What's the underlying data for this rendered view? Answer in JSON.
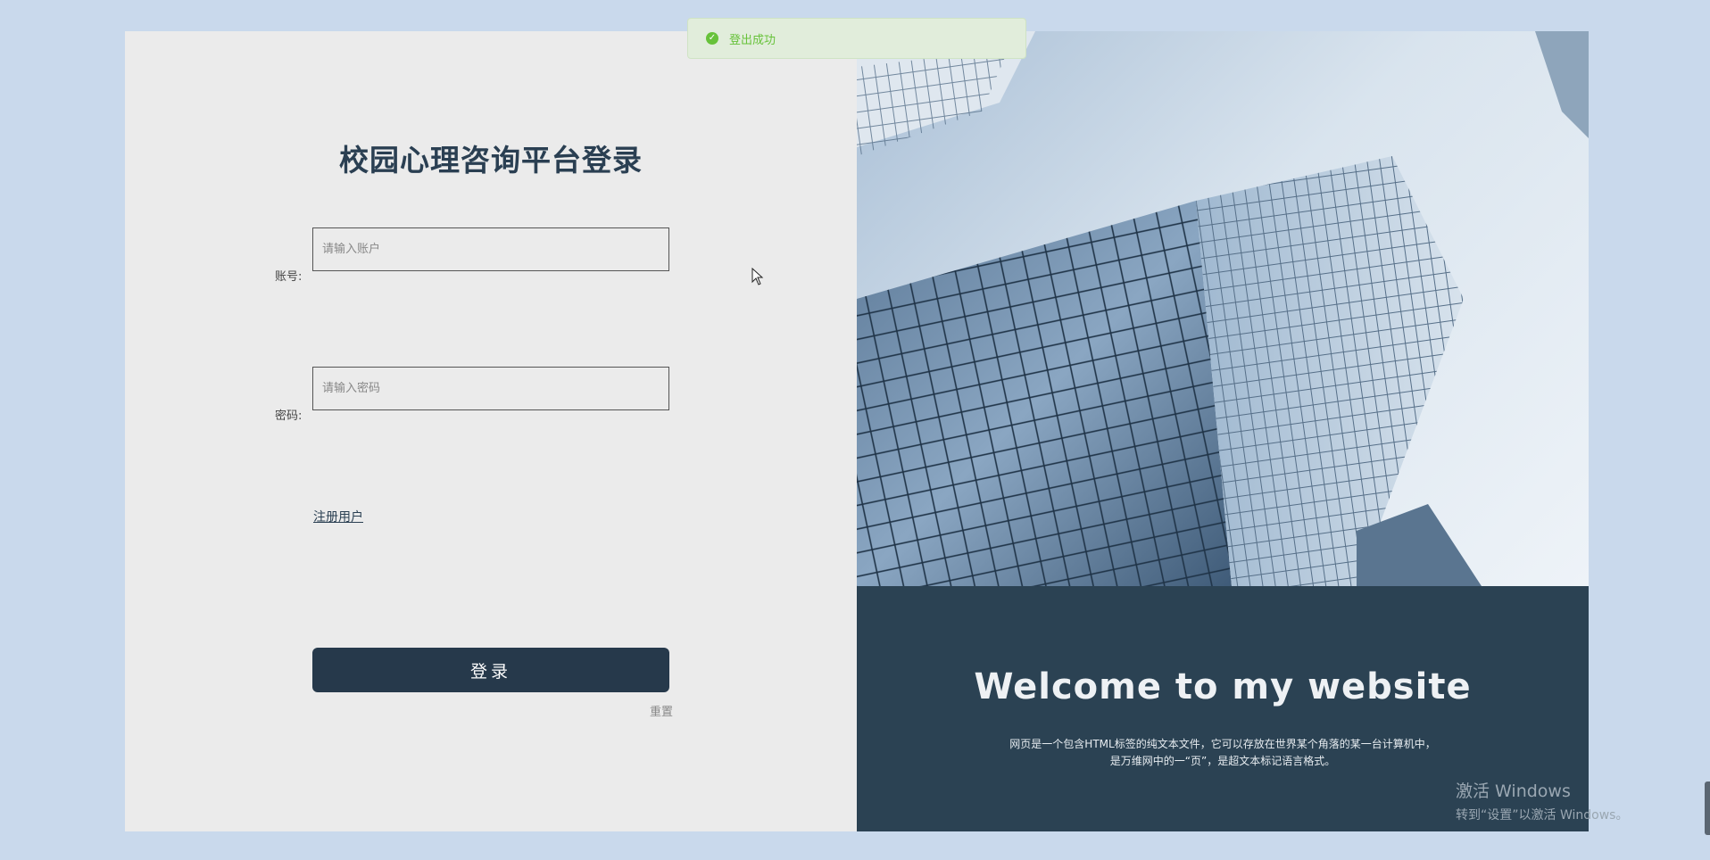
{
  "login": {
    "title": "校园心理咨询平台登录",
    "account_label": "账号:",
    "account_placeholder": "请输入账户",
    "password_label": "密码:",
    "password_placeholder": "请输入密码",
    "register_link": "注册用户",
    "login_button": "登录",
    "reset_link": "重置"
  },
  "hero": {
    "welcome_title": "Welcome to my website",
    "welcome_desc_line1": "网页是一个包含HTML标签的纯文本文件，它可以存放在世界某个角落的某一台计算机中，",
    "welcome_desc_line2": "是万维网中的一“页”，是超文本标记语言格式。"
  },
  "toast": {
    "message": "登出成功",
    "icon": "check-circle-icon",
    "color": "#67c23a"
  },
  "watermark": {
    "title": "激活 Windows",
    "subtitle": "转到“设置”以激活 Windows。"
  },
  "colors": {
    "page_bg": "#c9d9ec",
    "panel_bg": "#ebebeb",
    "accent_dark": "#26394b",
    "welcome_bg": "#2b4253"
  }
}
